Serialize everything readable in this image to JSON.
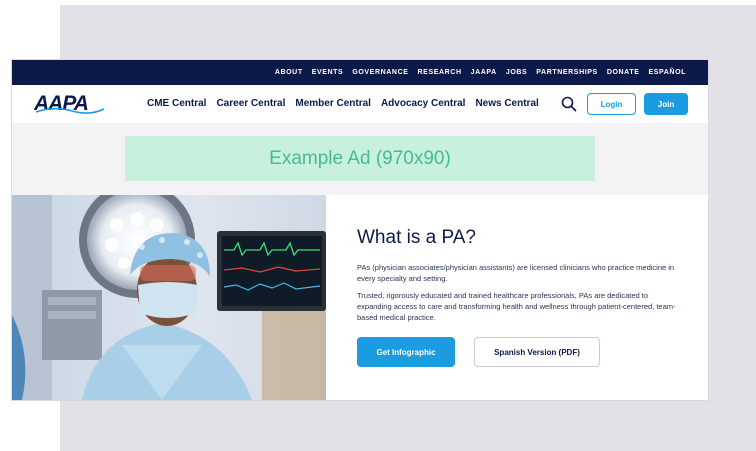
{
  "topbar": {
    "links": [
      "ABOUT",
      "EVENTS",
      "GOVERNANCE",
      "RESEARCH",
      "JAAPA",
      "JOBS",
      "PARTNERSHIPS",
      "DONATE",
      "ESPAÑOL"
    ]
  },
  "header": {
    "logo_text": "AAPA",
    "nav": [
      "CME Central",
      "Career Central",
      "Member Central",
      "Advocacy Central",
      "News Central"
    ],
    "login_label": "Login",
    "join_label": "Join"
  },
  "ad": {
    "label": "Example Ad (970x90)"
  },
  "hero": {
    "title": "What is a PA?",
    "paragraph1": "PAs (physician associates/physician assistants) are licensed clinicians who practice medicine in every specialty and setting.",
    "paragraph2": "Trusted, rigorously educated and trained healthcare professionals, PAs are dedicated to expanding access to care and transforming health and wellness through patient-centered, team-based medical practice.",
    "primary_cta": "Get Infographic",
    "secondary_cta": "Spanish Version (PDF)"
  },
  "colors": {
    "navy": "#0c1a4a",
    "brand_blue": "#1b9be0",
    "ad_bg": "#c8f0df",
    "ad_text": "#45bc8f"
  }
}
